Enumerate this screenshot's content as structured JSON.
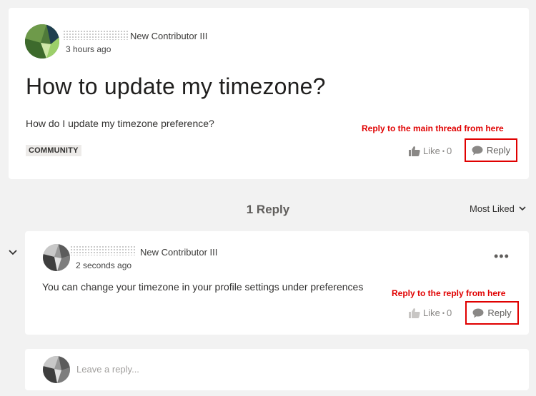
{
  "post": {
    "author_rank": "New Contributor III",
    "posted_time": "3 hours ago",
    "title": "How to update my timezone?",
    "body": "How do I update my timezone preference?",
    "tag": "COMMUNITY",
    "like_label": "Like",
    "like_separator": "•",
    "like_count": "0",
    "reply_label": "Reply",
    "annotation": "Reply to the main thread from here"
  },
  "replies_header": {
    "count_label": "1 Reply",
    "sort_label": "Most Liked"
  },
  "reply": {
    "author_rank": "New Contributor III",
    "posted_time": "2 seconds ago",
    "body": "You can change your timezone in your profile settings under preferences",
    "like_label": "Like",
    "like_separator": "•",
    "like_count": "0",
    "reply_label": "Reply",
    "annotation": "Reply to the reply from here",
    "more_icon": "more-options-icon"
  },
  "compose": {
    "placeholder": "Leave a reply..."
  },
  "colors": {
    "annotation": "#e00000",
    "background": "#f2f2f2",
    "card": "#ffffff"
  }
}
